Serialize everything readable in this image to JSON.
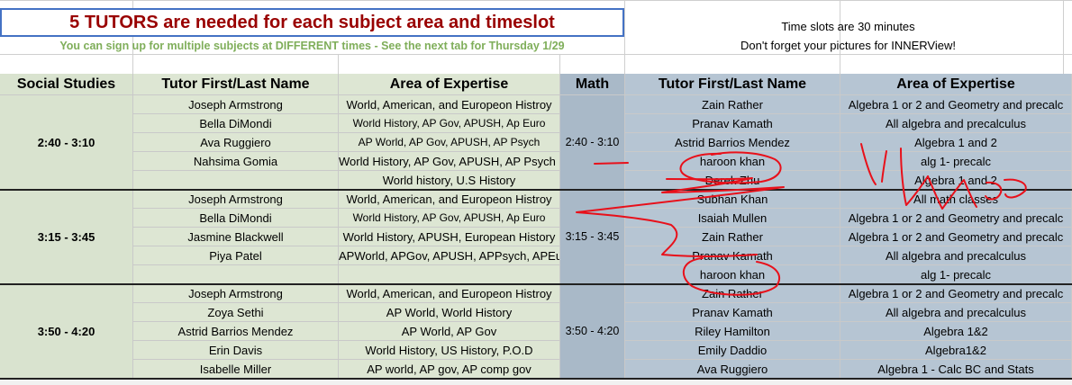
{
  "banner": {
    "title": "5 TUTORS are needed for each subject area and timeslot",
    "subtitle": "You can sign up for multiple subjects at DIFFERENT times - See the next tab for Thursday 1/29",
    "note1": "Time slots are 30 minutes",
    "note2": "Don't forget your pictures for INNERView!"
  },
  "headers": {
    "social_studies": "Social Studies",
    "tutor_ss": "Tutor First/Last Name",
    "expertise_ss": "Area of Expertise",
    "math": "Math",
    "tutor_math": "Tutor First/Last Name",
    "expertise_math": "Area of Expertise"
  },
  "slots": [
    {
      "time": "2:40 - 3:10",
      "social": [
        {
          "name": "Joseph Armstrong",
          "area": "World, American, and Europeon Histroy"
        },
        {
          "name": "Bella DiMondi",
          "area": "World History, AP Gov, APUSH, Ap Euro"
        },
        {
          "name": "Ava Ruggiero",
          "area": "AP World, AP Gov, APUSH, AP Psych"
        },
        {
          "name": "Nahsima Gomia",
          "area": "World History, AP Gov, APUSH, AP Psych"
        },
        {
          "name": "",
          "area": "World history, U.S History"
        }
      ],
      "math": [
        {
          "name": "Zain Rather",
          "area": "Algebra 1 or 2 and Geometry and precalc"
        },
        {
          "name": "Pranav Kamath",
          "area": "All algebra and precalculus"
        },
        {
          "name": "Astrid Barrios Mendez",
          "area": "Algebra 1 and 2"
        },
        {
          "name": "haroon khan",
          "area": "alg 1- precalc"
        },
        {
          "name": "Derek Zhu",
          "area": "Algebra 1 and 2"
        }
      ]
    },
    {
      "time": "3:15 - 3:45",
      "social": [
        {
          "name": "Joseph Armstrong",
          "area": "World, American, and Europeon Histroy"
        },
        {
          "name": "Bella DiMondi",
          "area": "World History, AP Gov, APUSH, Ap Euro"
        },
        {
          "name": "Jasmine Blackwell",
          "area": "World History, APUSH, European History"
        },
        {
          "name": "Piya Patel",
          "area": "APWorld, APGov, APUSH, APPsych, APEu"
        },
        {
          "name": "",
          "area": ""
        }
      ],
      "math": [
        {
          "name": "Subhan Khan",
          "area": "All math classes"
        },
        {
          "name": "Isaiah Mullen",
          "area": "Algebra 1 or 2 and Geometry and precalc"
        },
        {
          "name": "Zain Rather",
          "area": "Algebra 1 or 2 and Geometry and precalc"
        },
        {
          "name": "Pranav Kamath",
          "area": "All algebra and precalculus"
        },
        {
          "name": "haroon khan",
          "area": "alg 1- precalc"
        }
      ]
    },
    {
      "time": "3:50 - 4:20",
      "social": [
        {
          "name": "Joseph Armstrong",
          "area": "World, American, and Europeon Histroy"
        },
        {
          "name": "Zoya Sethi",
          "area": "AP World, World History"
        },
        {
          "name": "Astrid Barrios Mendez",
          "area": "AP World, AP Gov"
        },
        {
          "name": "Erin Davis",
          "area": "World History, US History, P.O.D"
        },
        {
          "name": "Isabelle Miller",
          "area": "AP world, AP gov, AP comp gov"
        }
      ],
      "math": [
        {
          "name": "Zain Rather",
          "area": "Algebra 1 or 2 and Geometry and precalc"
        },
        {
          "name": "Pranav Kamath",
          "area": "All algebra and precalculus"
        },
        {
          "name": "Riley Hamilton",
          "area": "Algebra 1&2"
        },
        {
          "name": "Emily Daddio",
          "area": "Algebra1&2"
        },
        {
          "name": "Ava Ruggiero",
          "area": "Algebra 1 - Calc BC and Stats"
        }
      ]
    }
  ],
  "colors": {
    "title_red": "#990000",
    "subtitle_green": "#7fae5a",
    "social_bg": "#d9e3cf",
    "math_bg": "#a9b9c8",
    "annotation_red": "#e8101a"
  }
}
